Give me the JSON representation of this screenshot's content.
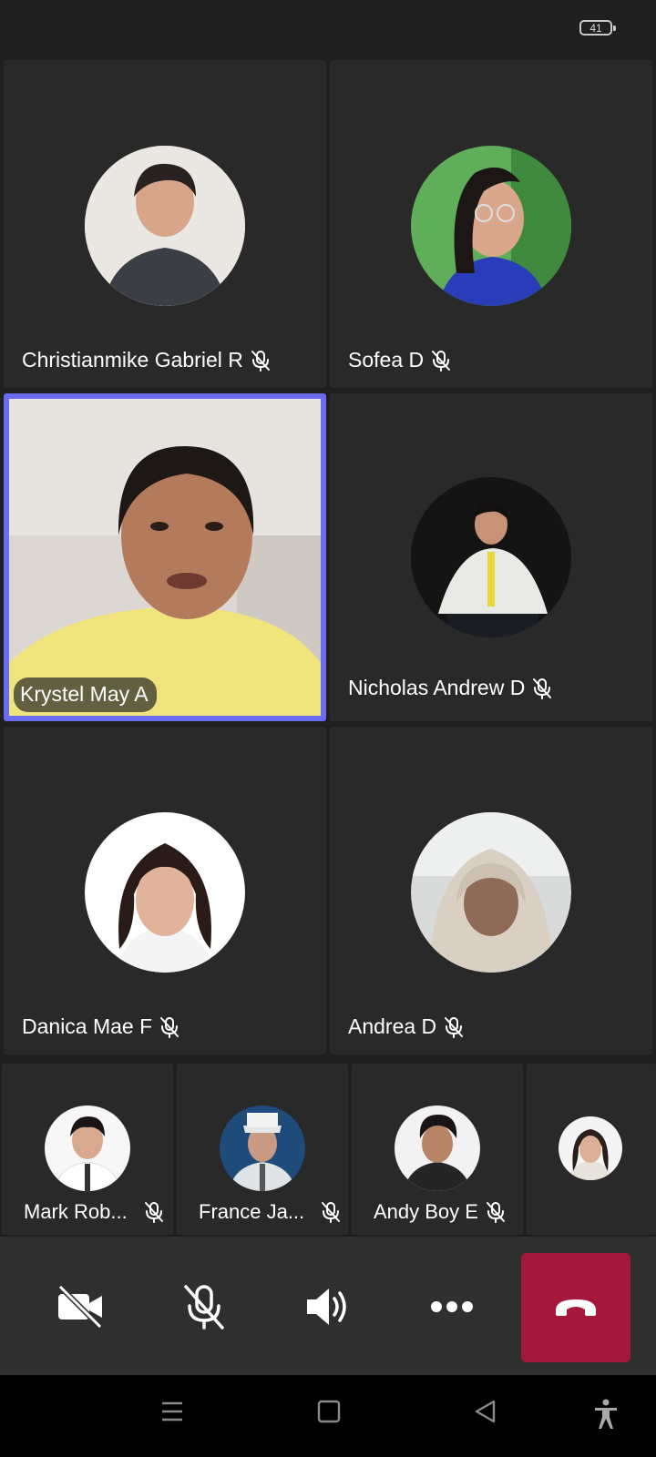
{
  "status_bar": {
    "battery": "41"
  },
  "participants": [
    {
      "name": "Christianmike Gabriel R",
      "muted": true
    },
    {
      "name": "Sofea D",
      "muted": true
    },
    {
      "name": "Krystel May A",
      "muted": false,
      "video_on": true,
      "active_speaker": true
    },
    {
      "name": "Nicholas Andrew D",
      "muted": true
    },
    {
      "name": "Danica Mae F",
      "muted": true
    },
    {
      "name": "Andrea D",
      "muted": true
    }
  ],
  "small_participants": [
    {
      "name": "Mark Rob...",
      "muted": true
    },
    {
      "name": "France Ja...",
      "muted": true
    },
    {
      "name": "Andy Boy E",
      "muted": true
    },
    {
      "name": "",
      "muted": false
    }
  ],
  "controls": [
    "camera-off",
    "mic-off",
    "speaker",
    "more-options",
    "end-call"
  ],
  "nav": [
    "recent-apps",
    "home",
    "back",
    "accessibility"
  ],
  "colors": {
    "active_border": "#6a6cf0",
    "end_call": "#a4193b",
    "tile": "#292929",
    "background": "#1f1f1f"
  }
}
